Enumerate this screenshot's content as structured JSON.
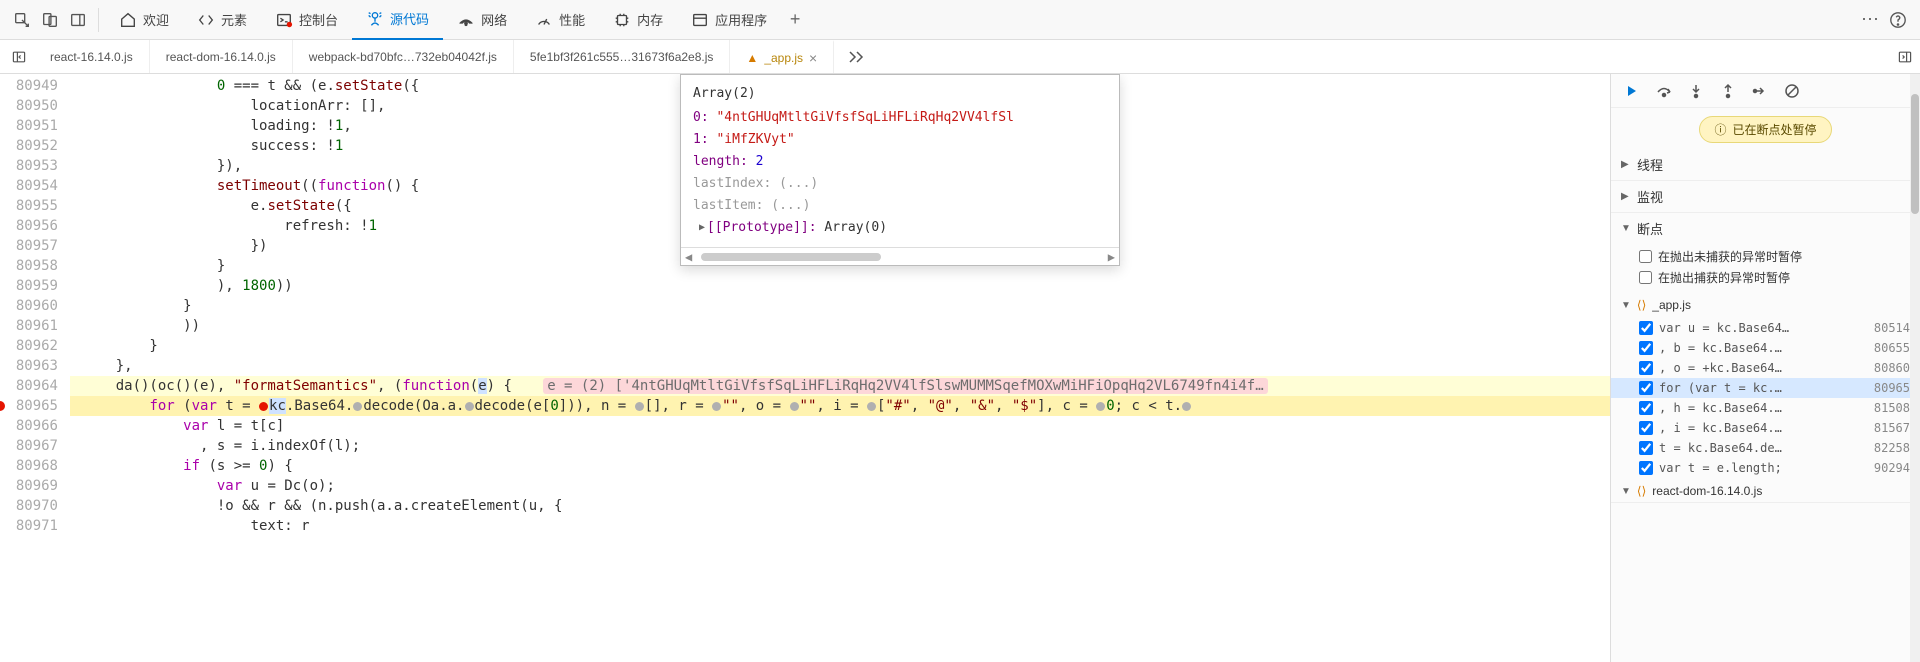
{
  "top_tabs": {
    "welcome": "欢迎",
    "elements": "元素",
    "console": "控制台",
    "sources": "源代码",
    "network": "网络",
    "performance": "性能",
    "memory": "内存",
    "application": "应用程序"
  },
  "file_tabs": {
    "t0": "react-16.14.0.js",
    "t1": "react-dom-16.14.0.js",
    "t2": "webpack-bd70bfc…732eb04042f.js",
    "t3": "5fe1bf3f261c555…31673f6a2e8.js",
    "t4": "_app.js"
  },
  "lines": {
    "start": 80949,
    "rows": [
      "                0 === t && (e.setState({",
      "                    locationArr: [],",
      "                    loading: !1,",
      "                    success: !1",
      "                }),",
      "                setTimeout((function() {",
      "                    e.setState({",
      "                        refresh: !1",
      "                    })",
      "                }",
      "                ), 1800))",
      "            }",
      "            ))",
      "        }",
      "    },",
      "    da()(oc()(e), \"formatSemantics\", (function(e) {",
      "        for (var t = kc.Base64.decode(Oa.a.decode(e[0])), n = [], r = \"\", o = \"\", i = [\"#\", \"@\", \"&\", \"$\"], c = 0; c < t.",
      "            var l = t[c]",
      "              , s = i.indexOf(l);",
      "            if (s >= 0) {",
      "                var u = Dc(o);",
      "                !o && r && (n.push(a.a.createElement(u, {",
      "                    text: r"
    ]
  },
  "inline_eval": "e = (2) ['4ntGHUqMtltGiVfsfSqLiHFLiRqHq2VV4lfSlswMUMMSqefMOXwMiHFiOpqHq2VL6749fn4i4f…",
  "popup": {
    "title": "Array(2)",
    "idx0_key": "0:",
    "idx0_val": "\"4ntGHUqMtltGiVfsfSqLiHFLiRqHq2VV4lfSl",
    "idx1_key": "1:",
    "idx1_val": "\"iMfZKVyt\"",
    "length_key": "length:",
    "length_val": "2",
    "lastIndex": "lastIndex: (...)",
    "lastItem": "lastItem: (...)",
    "proto_key": "[[Prototype]]:",
    "proto_val": "Array(0)"
  },
  "debugger": {
    "paused": "已在断点处暂停",
    "threads": "线程",
    "watch": "监视",
    "breakpoints": "断点",
    "pause_uncaught": "在抛出未捕获的异常时暂停",
    "pause_caught": "在抛出捕获的异常时暂停",
    "file_app": "_app.js",
    "file_reactdom": "react-dom-16.14.0.js",
    "bps": [
      {
        "txt": "var u = kc.Base64…",
        "ln": "80514"
      },
      {
        "txt": ", b = kc.Base64.…",
        "ln": "80655"
      },
      {
        "txt": ", o = +kc.Base64…",
        "ln": "80860"
      },
      {
        "txt": "for (var t = kc.…",
        "ln": "80965"
      },
      {
        "txt": ", h = kc.Base64.…",
        "ln": "81508"
      },
      {
        "txt": ", i = kc.Base64.…",
        "ln": "81567"
      },
      {
        "txt": "t = kc.Base64.de…",
        "ln": "82258"
      },
      {
        "txt": "var t = e.length;",
        "ln": "90294"
      }
    ]
  }
}
